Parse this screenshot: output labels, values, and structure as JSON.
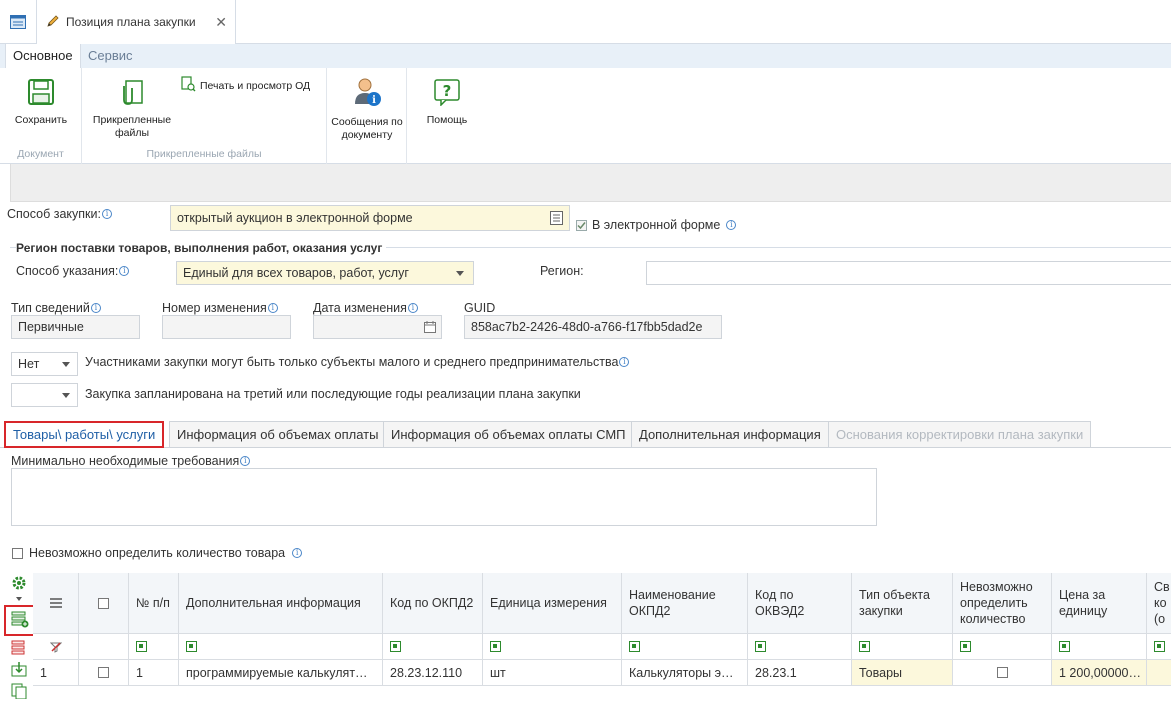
{
  "window_tab": {
    "title": "Позиция плана закупки",
    "close": "✕"
  },
  "ribbon": {
    "tabs": [
      "Основное",
      "Сервис"
    ],
    "buttons": {
      "save": "Сохранить",
      "attached_files": "Прикрепленные файлы",
      "print_preview": "Печать и просмотр ОД",
      "doc_messages": "Сообщения по документу",
      "help": "Помощь"
    },
    "groups": {
      "document": "Документ",
      "attached": "Прикрепленные файлы"
    }
  },
  "form": {
    "procurement_method_label": "Способ закупки:",
    "procurement_method_value": "открытый аукцион в электронной форме",
    "electronic_form_label": "В электронной форме",
    "electronic_form_checked": true,
    "region_section_title": "Регион поставки товаров, выполнения работ, оказания услуг",
    "specify_method_label": "Способ указания:",
    "specify_method_value": "Единый для всех товаров, работ, услуг",
    "region_label": "Регион:",
    "region_value": "",
    "info_type_label": "Тип сведений",
    "info_type_value": "Первичные",
    "change_number_label": "Номер изменения",
    "change_number_value": "",
    "change_date_label": "Дата изменения",
    "change_date_value": "",
    "guid_label": "GUID",
    "guid_value": "858ac7b2-2426-48d0-a766-f17fbb5dad2e",
    "smp_select_value": "Нет",
    "smp_label": "Участниками закупки могут быть только субъекты малого и среднего предпринимательства",
    "third_year_select_value": "",
    "third_year_label": "Закупка запланирована на третий или последующие годы реализации плана закупки"
  },
  "inner_tabs": [
    "Товары\\ работы\\ услуги",
    "Информация об объемах оплаты",
    "Информация об объемах оплаты СМП",
    "Дополнительная информация",
    "Основания корректировки плана закупки"
  ],
  "min_requirements_label": "Минимально необходимые требования",
  "min_requirements_value": "",
  "cannot_determine_label": "Невозможно определить количество товара",
  "grid": {
    "headers": [
      "№ п/п",
      "Дополнительная информация",
      "Код по ОКПД2",
      "Единица измерения",
      "Наименование ОКПД2",
      "Код по ОКВЭД2",
      "Тип объекта закупки",
      "Невозможно определить количество",
      "Цена за единицу",
      "Св ко (о"
    ],
    "rows": [
      {
        "index": "1",
        "num": "1",
        "additional": "программируемые калькулят…",
        "okpd2": "28.23.12.110",
        "unit": "шт",
        "okpd2_name": "Калькуляторы э…",
        "okved2": "28.23.1",
        "object_type": "Товары",
        "cannot_determine": false,
        "price": "1 200,00000…"
      }
    ]
  }
}
